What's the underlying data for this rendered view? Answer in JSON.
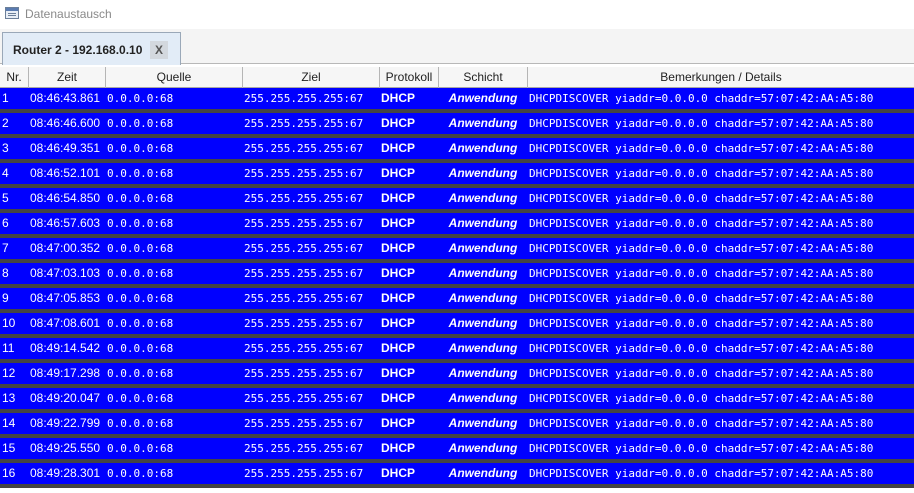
{
  "window": {
    "title": "Datenaustausch",
    "icon": "window-icon"
  },
  "tabs": [
    {
      "label": "Router 2 - 192.168.0.10",
      "close_label": "X"
    }
  ],
  "table": {
    "columns": [
      "Nr.",
      "Zeit",
      "Quelle",
      "Ziel",
      "Protokoll",
      "Schicht",
      "Bemerkungen / Details"
    ],
    "row_color": "#0000ff",
    "separator_color": "#444444",
    "rows": [
      {
        "nr": "1",
        "zeit": "08:46:43.861",
        "quelle": "0.0.0.0:68",
        "ziel": "255.255.255.255:67",
        "protokoll": "DHCP",
        "schicht": "Anwendung",
        "details": "DHCPDISCOVER yiaddr=0.0.0.0 chaddr=57:07:42:AA:A5:80"
      },
      {
        "nr": "2",
        "zeit": "08:46:46.600",
        "quelle": "0.0.0.0:68",
        "ziel": "255.255.255.255:67",
        "protokoll": "DHCP",
        "schicht": "Anwendung",
        "details": "DHCPDISCOVER yiaddr=0.0.0.0 chaddr=57:07:42:AA:A5:80"
      },
      {
        "nr": "3",
        "zeit": "08:46:49.351",
        "quelle": "0.0.0.0:68",
        "ziel": "255.255.255.255:67",
        "protokoll": "DHCP",
        "schicht": "Anwendung",
        "details": "DHCPDISCOVER yiaddr=0.0.0.0 chaddr=57:07:42:AA:A5:80"
      },
      {
        "nr": "4",
        "zeit": "08:46:52.101",
        "quelle": "0.0.0.0:68",
        "ziel": "255.255.255.255:67",
        "protokoll": "DHCP",
        "schicht": "Anwendung",
        "details": "DHCPDISCOVER yiaddr=0.0.0.0 chaddr=57:07:42:AA:A5:80"
      },
      {
        "nr": "5",
        "zeit": "08:46:54.850",
        "quelle": "0.0.0.0:68",
        "ziel": "255.255.255.255:67",
        "protokoll": "DHCP",
        "schicht": "Anwendung",
        "details": "DHCPDISCOVER yiaddr=0.0.0.0 chaddr=57:07:42:AA:A5:80"
      },
      {
        "nr": "6",
        "zeit": "08:46:57.603",
        "quelle": "0.0.0.0:68",
        "ziel": "255.255.255.255:67",
        "protokoll": "DHCP",
        "schicht": "Anwendung",
        "details": "DHCPDISCOVER yiaddr=0.0.0.0 chaddr=57:07:42:AA:A5:80"
      },
      {
        "nr": "7",
        "zeit": "08:47:00.352",
        "quelle": "0.0.0.0:68",
        "ziel": "255.255.255.255:67",
        "protokoll": "DHCP",
        "schicht": "Anwendung",
        "details": "DHCPDISCOVER yiaddr=0.0.0.0 chaddr=57:07:42:AA:A5:80"
      },
      {
        "nr": "8",
        "zeit": "08:47:03.103",
        "quelle": "0.0.0.0:68",
        "ziel": "255.255.255.255:67",
        "protokoll": "DHCP",
        "schicht": "Anwendung",
        "details": "DHCPDISCOVER yiaddr=0.0.0.0 chaddr=57:07:42:AA:A5:80"
      },
      {
        "nr": "9",
        "zeit": "08:47:05.853",
        "quelle": "0.0.0.0:68",
        "ziel": "255.255.255.255:67",
        "protokoll": "DHCP",
        "schicht": "Anwendung",
        "details": "DHCPDISCOVER yiaddr=0.0.0.0 chaddr=57:07:42:AA:A5:80"
      },
      {
        "nr": "10",
        "zeit": "08:47:08.601",
        "quelle": "0.0.0.0:68",
        "ziel": "255.255.255.255:67",
        "protokoll": "DHCP",
        "schicht": "Anwendung",
        "details": "DHCPDISCOVER yiaddr=0.0.0.0 chaddr=57:07:42:AA:A5:80"
      },
      {
        "nr": "11",
        "zeit": "08:49:14.542",
        "quelle": "0.0.0.0:68",
        "ziel": "255.255.255.255:67",
        "protokoll": "DHCP",
        "schicht": "Anwendung",
        "details": "DHCPDISCOVER yiaddr=0.0.0.0 chaddr=57:07:42:AA:A5:80"
      },
      {
        "nr": "12",
        "zeit": "08:49:17.298",
        "quelle": "0.0.0.0:68",
        "ziel": "255.255.255.255:67",
        "protokoll": "DHCP",
        "schicht": "Anwendung",
        "details": "DHCPDISCOVER yiaddr=0.0.0.0 chaddr=57:07:42:AA:A5:80"
      },
      {
        "nr": "13",
        "zeit": "08:49:20.047",
        "quelle": "0.0.0.0:68",
        "ziel": "255.255.255.255:67",
        "protokoll": "DHCP",
        "schicht": "Anwendung",
        "details": "DHCPDISCOVER yiaddr=0.0.0.0 chaddr=57:07:42:AA:A5:80"
      },
      {
        "nr": "14",
        "zeit": "08:49:22.799",
        "quelle": "0.0.0.0:68",
        "ziel": "255.255.255.255:67",
        "protokoll": "DHCP",
        "schicht": "Anwendung",
        "details": "DHCPDISCOVER yiaddr=0.0.0.0 chaddr=57:07:42:AA:A5:80"
      },
      {
        "nr": "15",
        "zeit": "08:49:25.550",
        "quelle": "0.0.0.0:68",
        "ziel": "255.255.255.255:67",
        "protokoll": "DHCP",
        "schicht": "Anwendung",
        "details": "DHCPDISCOVER yiaddr=0.0.0.0 chaddr=57:07:42:AA:A5:80"
      },
      {
        "nr": "16",
        "zeit": "08:49:28.301",
        "quelle": "0.0.0.0:68",
        "ziel": "255.255.255.255:67",
        "protokoll": "DHCP",
        "schicht": "Anwendung",
        "details": "DHCPDISCOVER yiaddr=0.0.0.0 chaddr=57:07:42:AA:A5:80"
      }
    ]
  }
}
